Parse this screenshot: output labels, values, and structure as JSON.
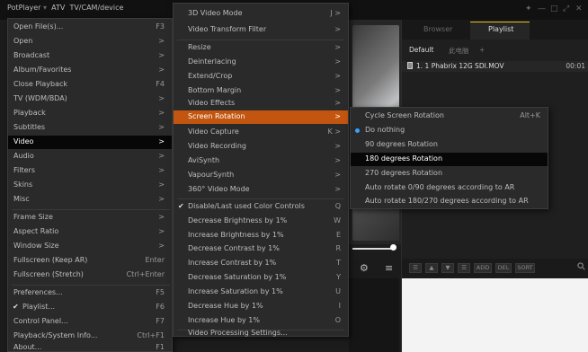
{
  "titlebar": {
    "app_name": "PotPlayer",
    "items": [
      "ATV",
      "TV/CAM/device"
    ],
    "sep": "▾"
  },
  "window_controls": [
    "✦",
    "—",
    "□",
    "⤢",
    "✕"
  ],
  "playlist_panel": {
    "tabs": [
      "Browser",
      "Playlist"
    ],
    "subtabs": [
      "Default",
      "此电脑",
      "+"
    ],
    "item": {
      "name": "1. 1 Phabrix 12G SDI.MOV",
      "time": "00:01"
    },
    "toolbar_buttons": [
      "☰",
      "▲",
      "▼",
      "☰",
      "ADD",
      "DEL",
      "SORT"
    ]
  },
  "controls": {
    "gear": "⚙",
    "menu": "≡"
  },
  "main_menu": {
    "items": [
      {
        "label": "Open File(s)...",
        "key": "F3"
      },
      {
        "label": "Open",
        "key": ">"
      },
      {
        "label": "Broadcast",
        "key": ">"
      },
      {
        "label": "Album/Favorites",
        "key": ">"
      },
      {
        "label": "Close Playback",
        "key": "F4"
      },
      {
        "label": "TV (WDM/BDA)",
        "key": ">"
      },
      {
        "label": "Playback",
        "key": ">"
      },
      {
        "label": "Subtitles",
        "key": ">"
      },
      {
        "label": "Video",
        "key": ">"
      },
      {
        "label": "Audio",
        "key": ">"
      },
      {
        "label": "Filters",
        "key": ">"
      },
      {
        "label": "Skins",
        "key": ">"
      },
      {
        "label": "Misc",
        "key": ">"
      },
      {
        "label": "Frame Size",
        "key": ">"
      },
      {
        "label": "Aspect Ratio",
        "key": ">"
      },
      {
        "label": "Window Size",
        "key": ">"
      },
      {
        "label": "Fullscreen (Keep AR)",
        "key": "Enter"
      },
      {
        "label": "Fullscreen (Stretch)",
        "key": "Ctrl+Enter"
      },
      {
        "label": "Preferences...",
        "key": "F5"
      },
      {
        "label": "Playlist...",
        "key": "F6"
      },
      {
        "label": "Control Panel...",
        "key": "F7"
      },
      {
        "label": "Playback/System Info...",
        "key": "Ctrl+F1"
      },
      {
        "label": "About...",
        "key": "F1"
      }
    ]
  },
  "video_menu": {
    "items": [
      {
        "label": "3D Video Mode",
        "key": "J >"
      },
      {
        "label": "Video Transform Filter",
        "key": ">"
      },
      {
        "label": "Resize",
        "key": ">"
      },
      {
        "label": "Deinterlacing",
        "key": ">"
      },
      {
        "label": "Extend/Crop",
        "key": ">"
      },
      {
        "label": "Bottom Margin",
        "key": ">"
      },
      {
        "label": "Video Effects",
        "key": ">"
      },
      {
        "label": "Screen Rotation",
        "key": ">"
      },
      {
        "label": "Video Capture",
        "key": "K >"
      },
      {
        "label": "Video Recording",
        "key": ">"
      },
      {
        "label": "AviSynth",
        "key": ">"
      },
      {
        "label": "VapourSynth",
        "key": ">"
      },
      {
        "label": "360° Video Mode",
        "key": ">"
      },
      {
        "label": "Disable/Last used Color Controls",
        "key": "Q"
      },
      {
        "label": "Decrease Brightness by 1%",
        "key": "W"
      },
      {
        "label": "Increase Brightness by 1%",
        "key": "E"
      },
      {
        "label": "Decrease Contrast by 1%",
        "key": "R"
      },
      {
        "label": "Increase Contrast by 1%",
        "key": "T"
      },
      {
        "label": "Decrease Saturation by 1%",
        "key": "Y"
      },
      {
        "label": "Increase Saturation by 1%",
        "key": "U"
      },
      {
        "label": "Decrease Hue by 1%",
        "key": "I"
      },
      {
        "label": "Increase Hue by 1%",
        "key": "O"
      },
      {
        "label": "Video Processing Settings...",
        "key": ""
      }
    ]
  },
  "rotation_menu": {
    "items": [
      {
        "label": "Cycle Screen Rotation",
        "key": "Alt+K"
      },
      {
        "label": "Do nothing",
        "key": ""
      },
      {
        "label": "90 degrees Rotation",
        "key": ""
      },
      {
        "label": "180 degrees Rotation",
        "key": ""
      },
      {
        "label": "270 degrees Rotation",
        "key": ""
      },
      {
        "label": "Auto rotate 0/90 degrees according to AR",
        "key": ""
      },
      {
        "label": "Auto rotate 180/270 degrees according to AR",
        "key": ""
      }
    ]
  },
  "marks": {
    "check": "✔"
  },
  "colors": {
    "highlight_orange": "#c2550f",
    "highlight_black": "#070707",
    "radio_blue": "#3aa0ff",
    "tab_accent": "#f0c020"
  }
}
